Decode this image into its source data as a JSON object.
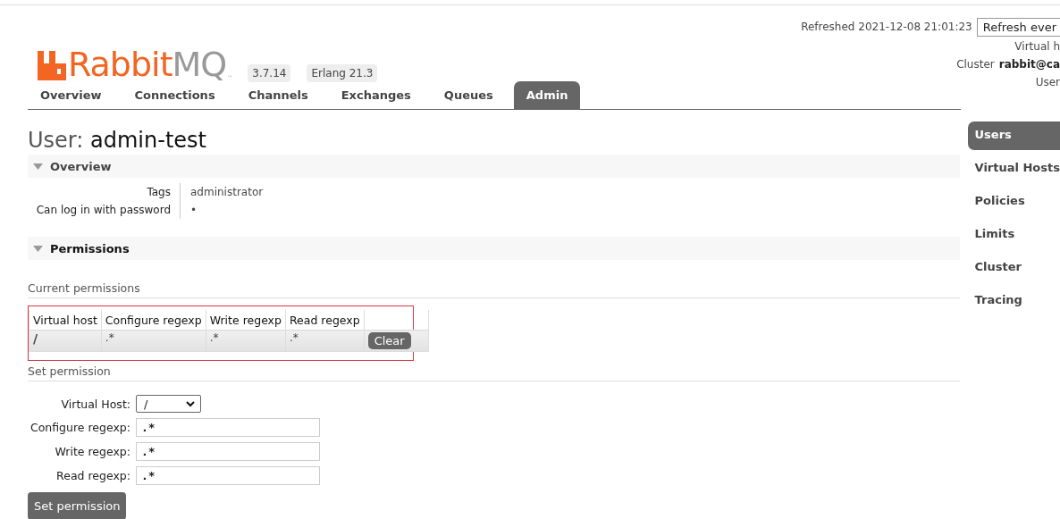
{
  "logo": {
    "brand": "Rabbit",
    "product": "MQ",
    "mark": "™"
  },
  "badges": [
    "3.7.14",
    "Erlang 21.3"
  ],
  "status": {
    "refreshed": "Refreshed 2021-12-08 21:01:23",
    "refresh_select": "Refresh ever",
    "virtual_host": "Virtual h",
    "cluster_label": "Cluster",
    "cluster_value": "rabbit@ca",
    "user_label": "User"
  },
  "tabs": [
    {
      "label": "Overview",
      "selected": false
    },
    {
      "label": "Connections",
      "selected": false
    },
    {
      "label": "Channels",
      "selected": false
    },
    {
      "label": "Exchanges",
      "selected": false
    },
    {
      "label": "Queues",
      "selected": false
    },
    {
      "label": "Admin",
      "selected": true
    }
  ],
  "title": {
    "prefix": "User:",
    "name": "admin-test"
  },
  "overview": {
    "heading": "Overview",
    "expanded": true,
    "rows": [
      {
        "key": "Tags",
        "value": "administrator"
      },
      {
        "key": "Can log in with password",
        "value": "•"
      }
    ]
  },
  "permissions": {
    "heading": "Permissions",
    "expanded": true,
    "current_label": "Current permissions",
    "table": {
      "columns": [
        "Virtual host",
        "Configure regexp",
        "Write regexp",
        "Read regexp"
      ],
      "rows": [
        {
          "cells": [
            "/",
            ".*",
            ".*",
            ".*"
          ],
          "action": "Clear"
        }
      ]
    },
    "set_label": "Set permission",
    "form": [
      {
        "label": "Virtual Host:",
        "kind": "select",
        "value": "/"
      },
      {
        "label": "Configure regexp:",
        "kind": "text",
        "value": ".*"
      },
      {
        "label": "Write regexp:",
        "kind": "text",
        "value": ".*"
      },
      {
        "label": "Read regexp:",
        "kind": "text",
        "value": ".*"
      }
    ],
    "submit": "Set permission"
  },
  "sidebar": {
    "items": [
      {
        "label": "Users",
        "selected": true
      },
      {
        "label": "Virtual Hosts",
        "selected": false
      },
      {
        "label": "Policies",
        "selected": false
      },
      {
        "label": "Limits",
        "selected": false
      },
      {
        "label": "Cluster",
        "selected": false
      },
      {
        "label": "Tracing",
        "selected": false
      }
    ]
  }
}
